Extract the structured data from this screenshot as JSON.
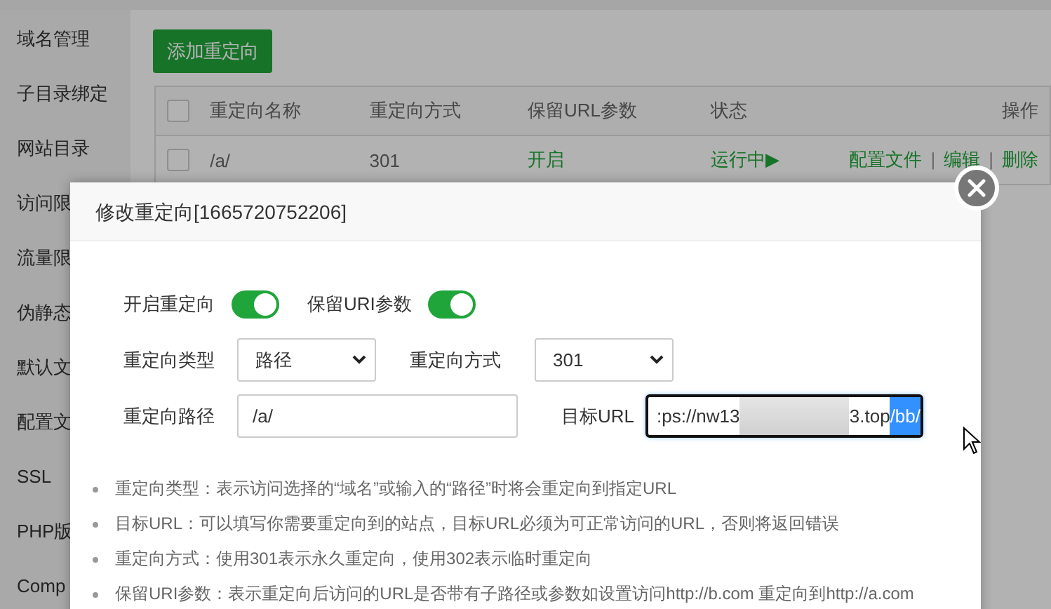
{
  "sidebar": {
    "items": [
      {
        "label": "域名管理"
      },
      {
        "label": "子目录绑定"
      },
      {
        "label": "网站目录"
      },
      {
        "label": "访问限"
      },
      {
        "label": "流量限"
      },
      {
        "label": "伪静态"
      },
      {
        "label": "默认文"
      },
      {
        "label": "配置文"
      },
      {
        "label": "SSL"
      },
      {
        "label": "PHP版"
      },
      {
        "label": "Comp"
      }
    ]
  },
  "add_button": "添加重定向",
  "table": {
    "header_checked": false,
    "columns": [
      "重定向名称",
      "重定向方式",
      "保留URL参数",
      "状态",
      "操作"
    ],
    "rows": [
      {
        "checked": false,
        "name": "/a/",
        "method": "301",
        "keep_params": "开启",
        "status": "运行中▶",
        "actions": [
          "配置文件",
          "编辑",
          "删除"
        ],
        "separator": "|"
      }
    ]
  },
  "dialog": {
    "title": "修改重定向[1665720752206]",
    "toggles": [
      {
        "label": "开启重定向",
        "on": true
      },
      {
        "label": "保留URI参数",
        "on": true
      }
    ],
    "type": {
      "label": "重定向类型",
      "value": "路径"
    },
    "method": {
      "label": "重定向方式",
      "value": "301"
    },
    "path": {
      "label": "重定向路径",
      "value": "/a/"
    },
    "target": {
      "label": "目标URL",
      "value_before": ":ps://nw13",
      "value_after": "3.top",
      "selected_text": "/bb/"
    },
    "hints": [
      "重定向类型：表示访问选择的“域名”或输入的“路径”时将会重定向到指定URL",
      "目标URL：可以填写你需要重定向到的站点，目标URL必须为可正常访问的URL，否则将返回错误",
      "重定向方式：使用301表示永久重定向，使用302表示临时重定向",
      "保留URI参数：表示重定向后访问的URL是否带有子路径或参数如设置访问http://b.com 重定向到http://a.com"
    ]
  }
}
